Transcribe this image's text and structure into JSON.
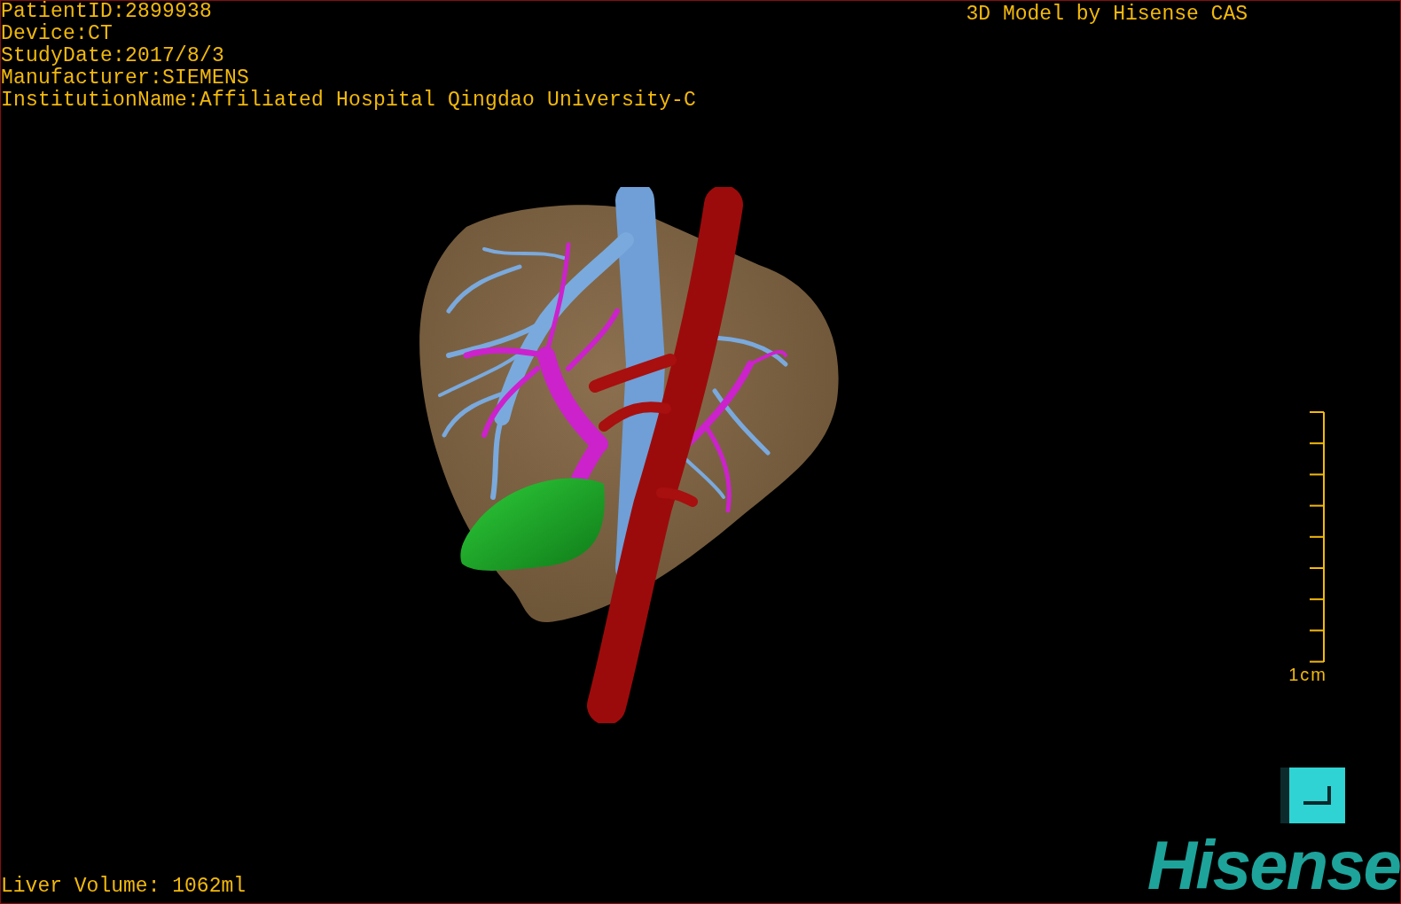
{
  "patient_info": [
    "PatientID:2899938",
    "Device:CT",
    "StudyDate:2017/8/3",
    "Manufacturer:SIEMENS",
    "InstitutionName:Affiliated Hospital Qingdao University-C"
  ],
  "model_title": "3D Model by Hisense CAS",
  "scale_bar": {
    "label": "1cm"
  },
  "liver_volume": "Liver Volume: 1062ml",
  "logo": "Hisense"
}
